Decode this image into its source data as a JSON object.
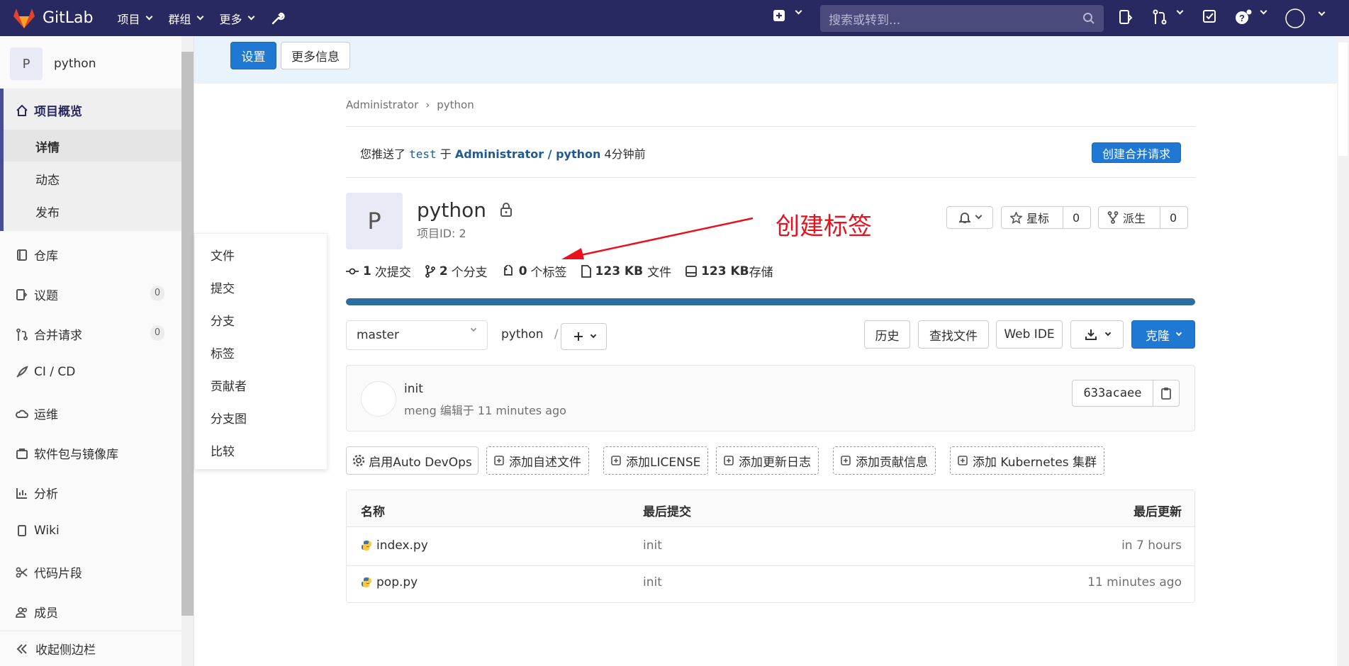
{
  "topbar": {
    "brand": "GitLab",
    "nav": [
      {
        "label": "项目"
      },
      {
        "label": "群组"
      },
      {
        "label": "更多"
      }
    ],
    "search_placeholder": "搜索或转到..."
  },
  "sidebar": {
    "project_letter": "P",
    "project_name": "python",
    "overview_label": "项目概览",
    "overview_sub": [
      "详情",
      "动态",
      "发布"
    ],
    "items": [
      {
        "label": "仓库"
      },
      {
        "label": "议题",
        "badge": "0"
      },
      {
        "label": "合并请求",
        "badge": "0"
      },
      {
        "label": "CI / CD"
      },
      {
        "label": "运维"
      },
      {
        "label": "软件包与镜像库"
      },
      {
        "label": "分析"
      },
      {
        "label": "Wiki"
      },
      {
        "label": "代码片段"
      },
      {
        "label": "成员"
      }
    ],
    "collapse_label": "收起侧边栏"
  },
  "banner": {
    "settings_label": "设置",
    "more_info_label": "更多信息"
  },
  "flyout": [
    "文件",
    "提交",
    "分支",
    "标签",
    "贡献者",
    "分支图",
    "比较"
  ],
  "breadcrumb": {
    "parent": "Administrator",
    "current": "python"
  },
  "push_notice": {
    "prefix": "您推送了",
    "branch": "test",
    "mid": "于",
    "project": "Administrator / python",
    "time": "4分钟前",
    "button": "创建合并请求"
  },
  "project": {
    "letter": "P",
    "name": "python",
    "id_text": "项目ID: 2",
    "star_label": "星标",
    "star_count": "0",
    "fork_label": "派生",
    "fork_count": "0"
  },
  "annotation": "创建标签",
  "stats": {
    "commits_num": "1",
    "commits_label": "次提交",
    "branches_num": "2",
    "branches_label": "个分支",
    "tags_num": "0",
    "tags_label": "个标签",
    "files_size": "123 KB",
    "files_label": "文件",
    "storage_size": "123 KB",
    "storage_label": "存储"
  },
  "repo_bar": {
    "branch": "master",
    "path": "python",
    "separator": "/",
    "history": "历史",
    "find_file": "查找文件",
    "web_ide": "Web IDE",
    "clone": "克隆"
  },
  "last_commit": {
    "title": "init",
    "author": "meng",
    "meta": "编辑于 11 minutes ago",
    "sha": "633acaee"
  },
  "actions": [
    "启用Auto DevOps",
    "添加自述文件",
    "添加LICENSE",
    "添加更新日志",
    "添加贡献信息",
    "添加 Kubernetes 集群"
  ],
  "files": {
    "headers": {
      "name": "名称",
      "last_commit": "最后提交",
      "last_update": "最后更新"
    },
    "rows": [
      {
        "name": "index.py",
        "commit": "init",
        "updated": "in 7 hours"
      },
      {
        "name": "pop.py",
        "commit": "init",
        "updated": "11 minutes ago"
      }
    ]
  },
  "colors": {
    "topbar": "#292961",
    "primary": "#1f78d1",
    "annotation": "#e8111d"
  }
}
